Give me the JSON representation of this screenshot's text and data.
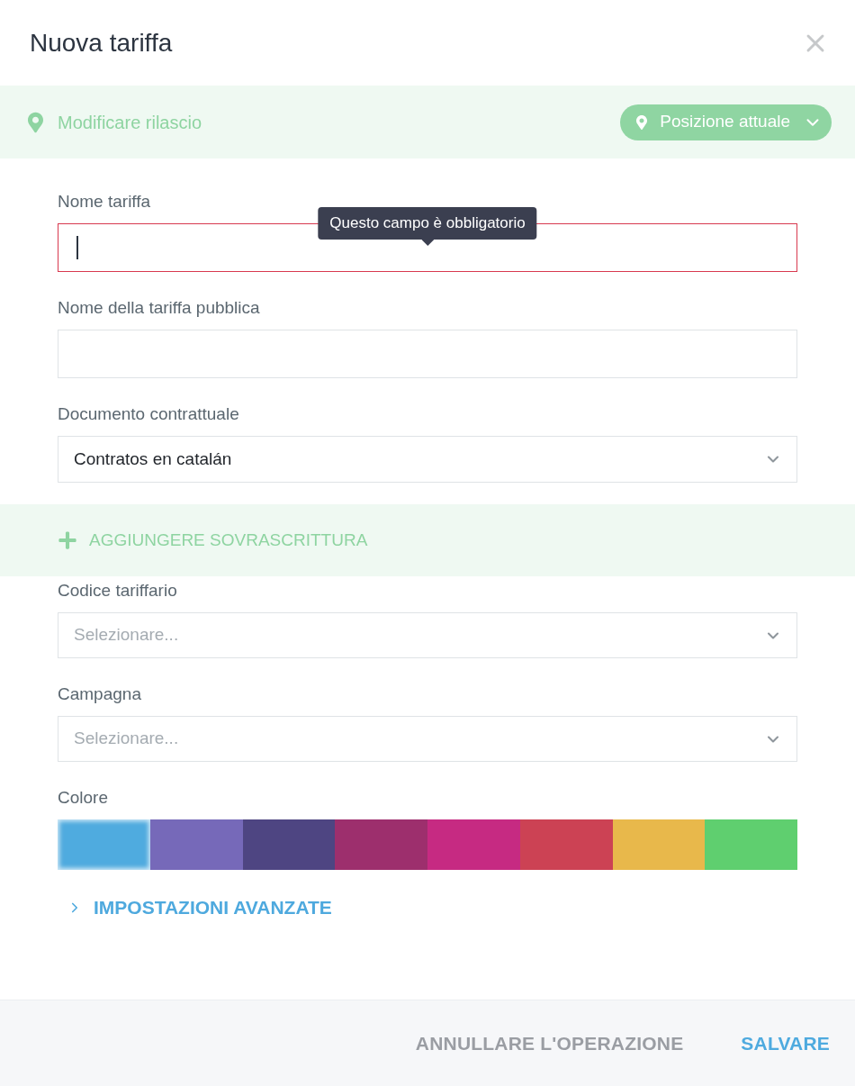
{
  "dialog": {
    "title": "Nuova tariffa"
  },
  "location_bar": {
    "label": "Modificare rilascio",
    "button": "Posizione attuale"
  },
  "fields": [
    {
      "kind": "text",
      "label": "Nome tariffa",
      "invalid": true,
      "focused": true,
      "tooltip": "Questo campo è obbligatorio"
    },
    {
      "kind": "text",
      "label": "Nome della tariffa pubblica",
      "invalid": false,
      "focused": false
    },
    {
      "kind": "select",
      "label": "Documento contrattuale",
      "value": "Contratos en catalán"
    }
  ],
  "override_bar": {
    "label": "AGGIUNGERE SOVRASCRITTURA"
  },
  "override_fields": [
    {
      "kind": "select",
      "label": "Codice tariffario",
      "placeholder": "Selezionare..."
    },
    {
      "kind": "select",
      "label": "Campagna",
      "placeholder": "Selezionare..."
    }
  ],
  "color": {
    "label": "Colore",
    "swatches": [
      {
        "color": "#4fabdf",
        "selected": true
      },
      {
        "color": "#7669b9",
        "selected": false
      },
      {
        "color": "#4e4582",
        "selected": false
      },
      {
        "color": "#9d2f6d",
        "selected": false
      },
      {
        "color": "#c62a82",
        "selected": false
      },
      {
        "color": "#cc4254",
        "selected": false
      },
      {
        "color": "#e8b84b",
        "selected": false
      },
      {
        "color": "#5fcf6f",
        "selected": false
      }
    ]
  },
  "advanced": {
    "label": "IMPOSTAZIONI AVANZATE",
    "expanded": false
  },
  "footer": {
    "buttons": [
      {
        "label": "ANNULLARE L'OPERAZIONE",
        "kind": "secondary"
      },
      {
        "label": "SALVARE",
        "kind": "primary"
      }
    ]
  }
}
